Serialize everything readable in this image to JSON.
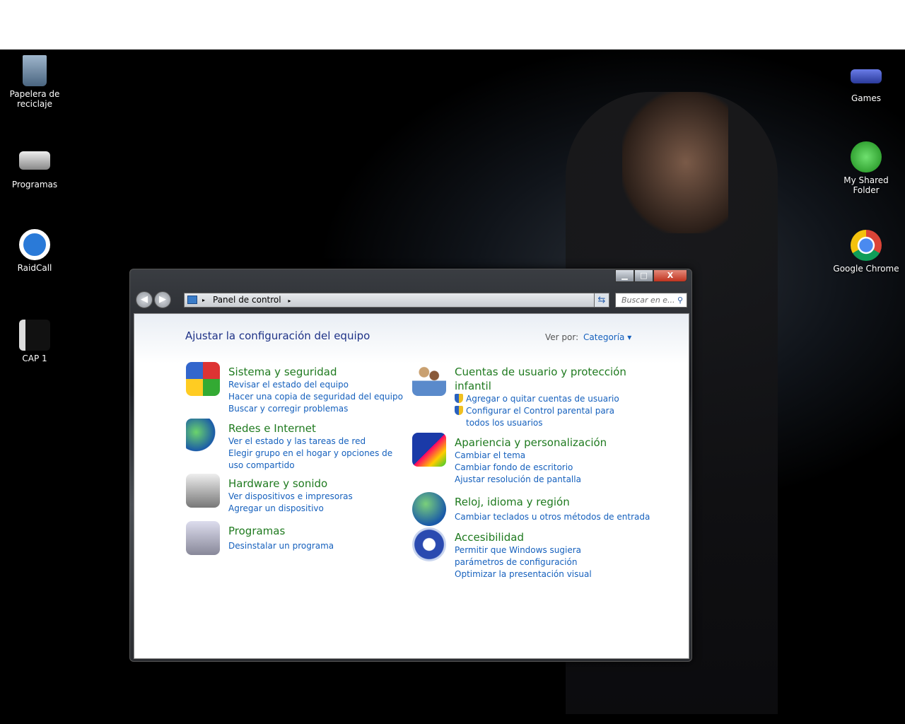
{
  "desktop": {
    "left_icons": [
      {
        "label": "Papelera de reciclaje"
      },
      {
        "label": "Programas"
      },
      {
        "label": "RaidCall"
      },
      {
        "label": "CAP 1"
      }
    ],
    "right_icons": [
      {
        "label": "Games"
      },
      {
        "label": "My Shared Folder"
      },
      {
        "label": "Google Chrome"
      }
    ]
  },
  "window": {
    "controls": {
      "minimize": "▁",
      "maximize": "□",
      "close": "X"
    },
    "address": {
      "crumb": "Panel de control",
      "sep": "▸"
    },
    "search_placeholder": "Buscar en e...",
    "title": "Ajustar la configuración del equipo",
    "view_by_label": "Ver por:",
    "view_by_value": "Categoría ▾",
    "left_groups": [
      {
        "heading": "Sistema y seguridad",
        "links": [
          "Revisar el estado del equipo",
          "Hacer una copia de seguridad del equipo",
          "Buscar y corregir problemas"
        ]
      },
      {
        "heading": "Redes e Internet",
        "links": [
          "Ver el estado y las tareas de red",
          "Elegir grupo en el hogar y opciones de uso compartido"
        ]
      },
      {
        "heading": "Hardware y sonido",
        "links": [
          "Ver dispositivos e impresoras",
          "Agregar un dispositivo"
        ]
      },
      {
        "heading": "Programas",
        "links": [
          "Desinstalar un programa"
        ]
      }
    ],
    "right_groups": [
      {
        "heading": "Cuentas de usuario y protección infantil",
        "links": [
          "Agregar o quitar cuentas de usuario",
          "Configurar el Control parental para todos los usuarios"
        ]
      },
      {
        "heading": "Apariencia y personalización",
        "links": [
          "Cambiar el tema",
          "Cambiar fondo de escritorio",
          "Ajustar resolución de pantalla"
        ]
      },
      {
        "heading": "Reloj, idioma y región",
        "links": [
          "Cambiar teclados u otros métodos de entrada"
        ]
      },
      {
        "heading": "Accesibilidad",
        "links": [
          "Permitir que Windows sugiera parámetros de configuración",
          "Optimizar la presentación visual"
        ]
      }
    ]
  }
}
